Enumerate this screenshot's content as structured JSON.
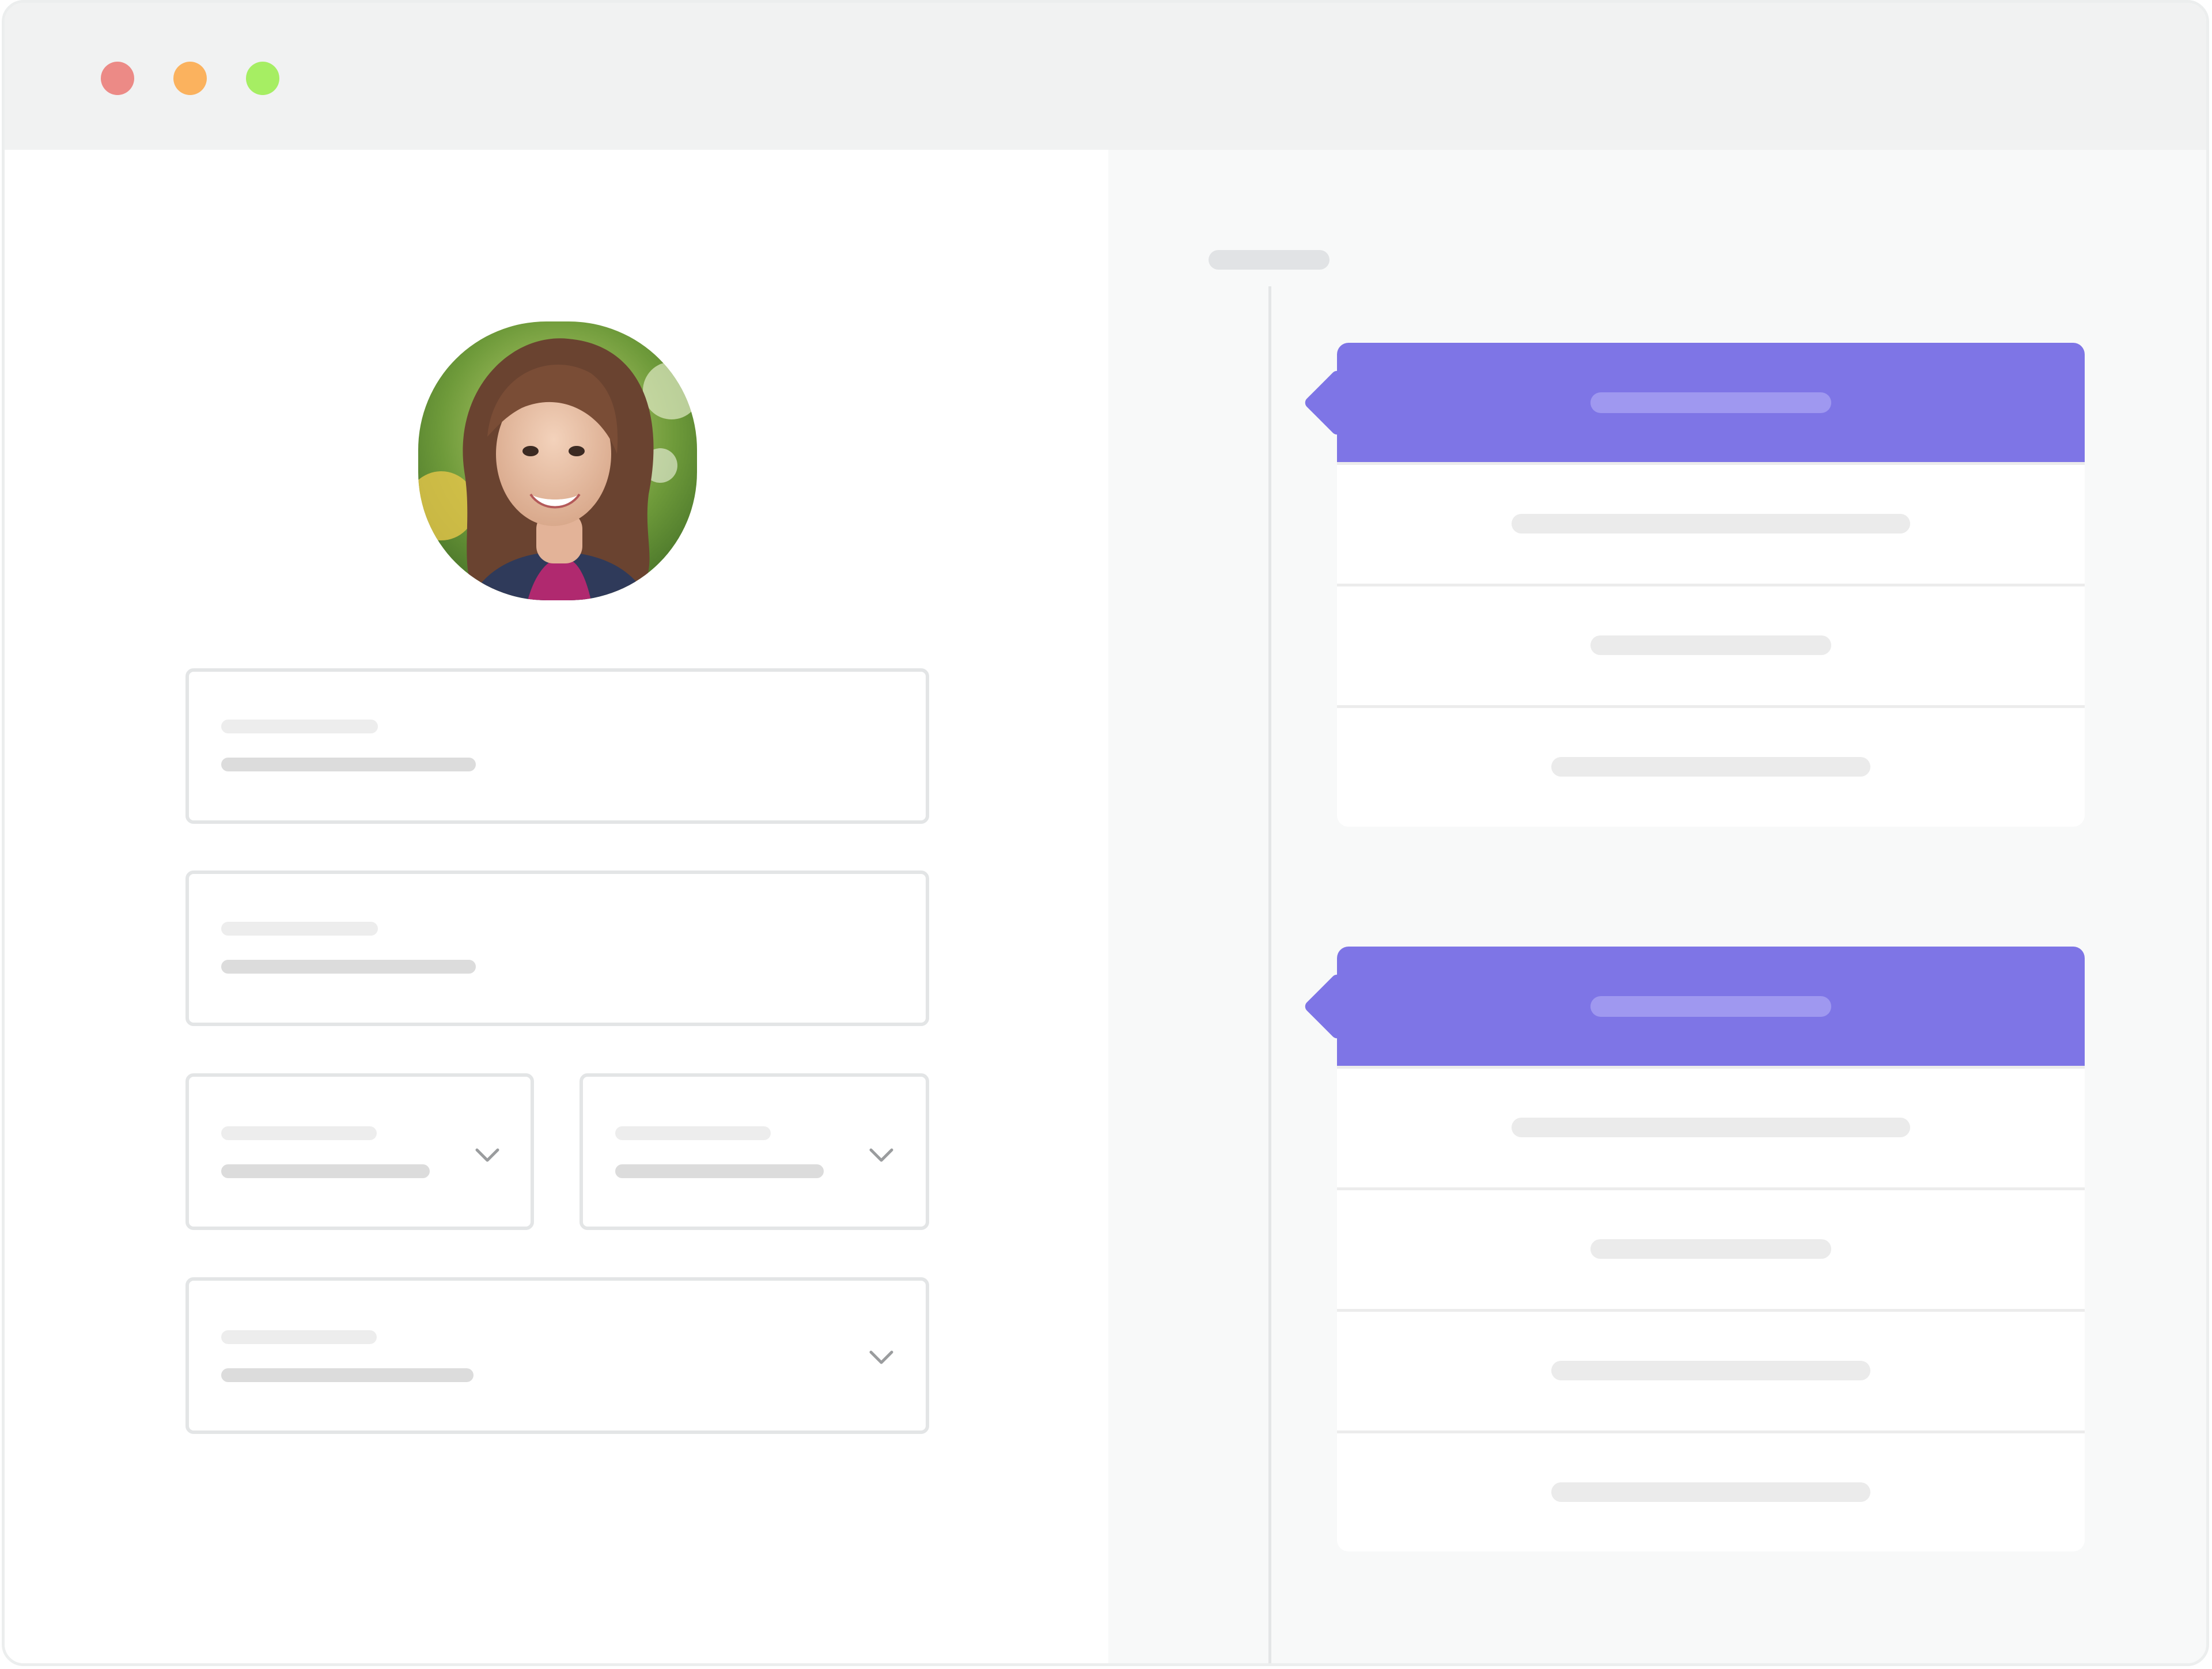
{
  "window": {
    "controls": {
      "close_color": "#ec8a86",
      "minimize_color": "#fbb25e",
      "maximize_color": "#a6ee63"
    }
  },
  "profile": {
    "avatar_icon": "profile-photo"
  },
  "form": {
    "fields": [
      {
        "type": "text",
        "label": "",
        "value": ""
      },
      {
        "type": "text",
        "label": "",
        "value": ""
      },
      {
        "type": "select",
        "label": "",
        "value": "",
        "icon": "chevron-down-icon"
      },
      {
        "type": "select",
        "label": "",
        "value": "",
        "icon": "chevron-down-icon"
      },
      {
        "type": "select",
        "label": "",
        "value": "",
        "icon": "chevron-down-icon"
      }
    ]
  },
  "timeline": {
    "label": "",
    "accent_color": "#7e75e6",
    "cards": [
      {
        "header": "",
        "rows": [
          "",
          "",
          ""
        ]
      },
      {
        "header": "",
        "rows": [
          "",
          "",
          "",
          ""
        ]
      }
    ]
  }
}
